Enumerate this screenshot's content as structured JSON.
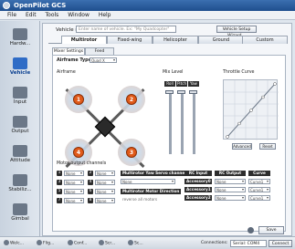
{
  "app": {
    "title": "OpenPilot GCS"
  },
  "menu": [
    "File",
    "Edit",
    "Tools",
    "Window",
    "Help"
  ],
  "sidebar": {
    "items": [
      {
        "label": "Hardw..."
      },
      {
        "label": "Vehicle"
      },
      {
        "label": "Input"
      },
      {
        "label": "Output"
      },
      {
        "label": "Attitude"
      },
      {
        "label": "Stabiliz..."
      },
      {
        "label": "Gimbal"
      }
    ]
  },
  "vehicle": {
    "name_label": "Vehicle name",
    "name_placeholder": "Enter name of vehicle. Ex: \"My Quadcopter\"",
    "wizard_button": "Vehicle Setup Wizard..."
  },
  "tabs": [
    "Multirotor",
    "Fixed-wing",
    "Helicopter",
    "Ground",
    "Custom"
  ],
  "subtabs": [
    "Mixer Settings",
    "Feed Forward"
  ],
  "airframe": {
    "type_label": "Airframe Type",
    "type_value": "Quad X",
    "section_label": "Airframe",
    "motors": [
      "1",
      "2",
      "3",
      "4"
    ]
  },
  "mix_level": {
    "label": "Mix Level",
    "headers": [
      "Roll",
      "Pitch",
      "Yaw"
    ],
    "values": [
      100,
      100,
      100
    ]
  },
  "throttle_curve": {
    "label": "Throttle Curve",
    "advanced_button": "Advanced",
    "reset_button": "Reset"
  },
  "outputs": {
    "section_label": "Motor output channels",
    "rows": [
      {
        "num": "1",
        "value": "None",
        "num2": "2",
        "value2": "None"
      },
      {
        "num": "3",
        "value": "None",
        "num2": "4",
        "value2": "None"
      },
      {
        "num": "5",
        "value": "None",
        "num2": "6",
        "value2": "None"
      },
      {
        "num": "7",
        "value": "None",
        "num2": "8",
        "value2": "None"
      }
    ],
    "yaw_servo_label": "Multirotor Yaw Servo channels",
    "yaw_servo_value": "None",
    "motor_dir_label": "Multirotor Motor Direction",
    "motor_dir_value": "reverse all motors",
    "rc_input_label": "RC Input",
    "rc_output_label": "RC Output",
    "curve_label": "Curve",
    "accessory_rows": [
      "Accessory0",
      "Accessory1",
      "Accessory2"
    ],
    "rc_value": "None",
    "curve_value": "Curve1"
  },
  "save": {
    "label": "Save"
  },
  "statusbar": {
    "items": [
      "Welc...",
      "Flig...",
      "Conf...",
      "Scr...",
      "Sc..."
    ],
    "connections_label": "Connections:",
    "connection_value": "Serial: COM4",
    "connect_button": "Connect"
  },
  "colors": {
    "accent": "#2f6cc6",
    "motor": "#e05a1a",
    "dark_label": "#2d2d2d"
  }
}
